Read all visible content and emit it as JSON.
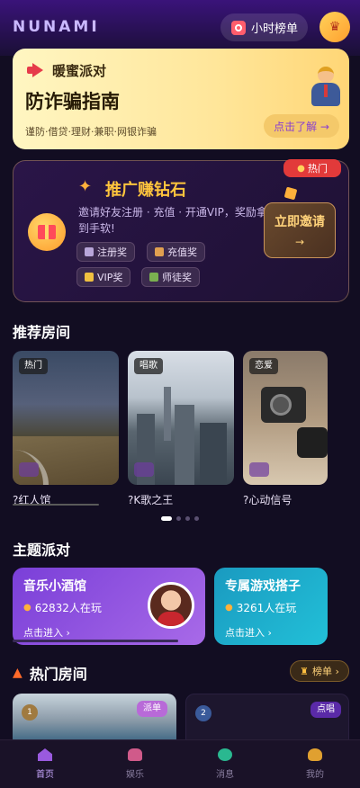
{
  "header": {
    "logo": "NUNAMI",
    "hour_rank_label": "小时榜单",
    "crown_icon": "crown-icon"
  },
  "banner": {
    "kicker": "暖蜜派对",
    "title": "防诈骗指南",
    "subtitle": "谨防·借贷·理财·兼职·网银诈骗",
    "button_label": "点击了解 →"
  },
  "promo": {
    "hot_tag": "热门",
    "title": "推广赚钻石",
    "description": "邀请好友注册 · 充值 · 开通VIP，奖励拿到手软!",
    "chips": [
      "注册奖",
      "充值奖",
      "VIP奖",
      "师徒奖"
    ],
    "invite_label": "立即邀请",
    "invite_arrow": "→"
  },
  "recommended": {
    "title": "推荐房间",
    "rooms": [
      {
        "tag": "热门",
        "name": "?红人馆"
      },
      {
        "tag": "唱歌",
        "name": "?K歌之王"
      },
      {
        "tag": "恋爱",
        "name": "?心动信号"
      }
    ]
  },
  "themes": {
    "title": "主题派对",
    "cards": [
      {
        "title": "音乐小酒馆",
        "count": "62832人在玩",
        "enter": "点击进入 ›",
        "color": "#8a4fe0"
      },
      {
        "title": "专属游戏搭子",
        "count": "3261人在玩",
        "enter": "点击进入 ›",
        "color": "#1aa7c8"
      }
    ]
  },
  "hot_rooms": {
    "title": "热门房间",
    "rank_label": "榜单 ›",
    "cards": [
      {
        "medal": "1",
        "tag": "派单"
      },
      {
        "medal": "2",
        "tag": "点唱"
      }
    ]
  },
  "tabbar": {
    "items": [
      {
        "label": "首页",
        "active": true
      },
      {
        "label": "娱乐",
        "active": false
      },
      {
        "label": "消息",
        "active": false
      },
      {
        "label": "我的",
        "active": false
      }
    ]
  }
}
